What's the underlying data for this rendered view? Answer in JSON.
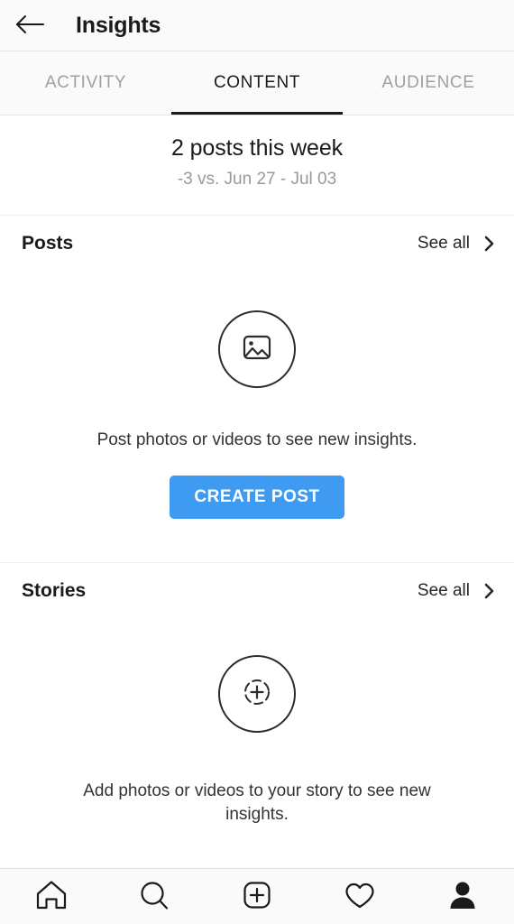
{
  "header": {
    "title": "Insights",
    "back_icon": "back-arrow-icon"
  },
  "tabs": [
    {
      "label": "ACTIVITY",
      "active": false
    },
    {
      "label": "CONTENT",
      "active": true
    },
    {
      "label": "AUDIENCE",
      "active": false
    }
  ],
  "summary": {
    "title": "2 posts this week",
    "subtitle": "-3 vs. Jun 27 - Jul 03"
  },
  "sections": {
    "posts": {
      "title": "Posts",
      "see_all_label": "See all",
      "chevron_icon": "chevron-right-icon",
      "empty_icon": "photo-icon",
      "empty_text": "Post photos or videos to see new insights.",
      "cta_label": "CREATE POST"
    },
    "stories": {
      "title": "Stories",
      "see_all_label": "See all",
      "chevron_icon": "chevron-right-icon",
      "empty_icon": "add-story-icon",
      "empty_text": "Add photos or videos to your story to see new insights."
    }
  },
  "bottom_nav": [
    {
      "icon": "home-icon",
      "active": false
    },
    {
      "icon": "search-icon",
      "active": false
    },
    {
      "icon": "add-post-icon",
      "active": false
    },
    {
      "icon": "heart-icon",
      "active": false
    },
    {
      "icon": "profile-icon",
      "active": true
    }
  ],
  "colors": {
    "accent_blue": "#3f9af1",
    "text_primary": "#262626",
    "text_muted": "#9a9a9a",
    "chrome_bg": "#fafafa",
    "divider": "#efefef"
  }
}
